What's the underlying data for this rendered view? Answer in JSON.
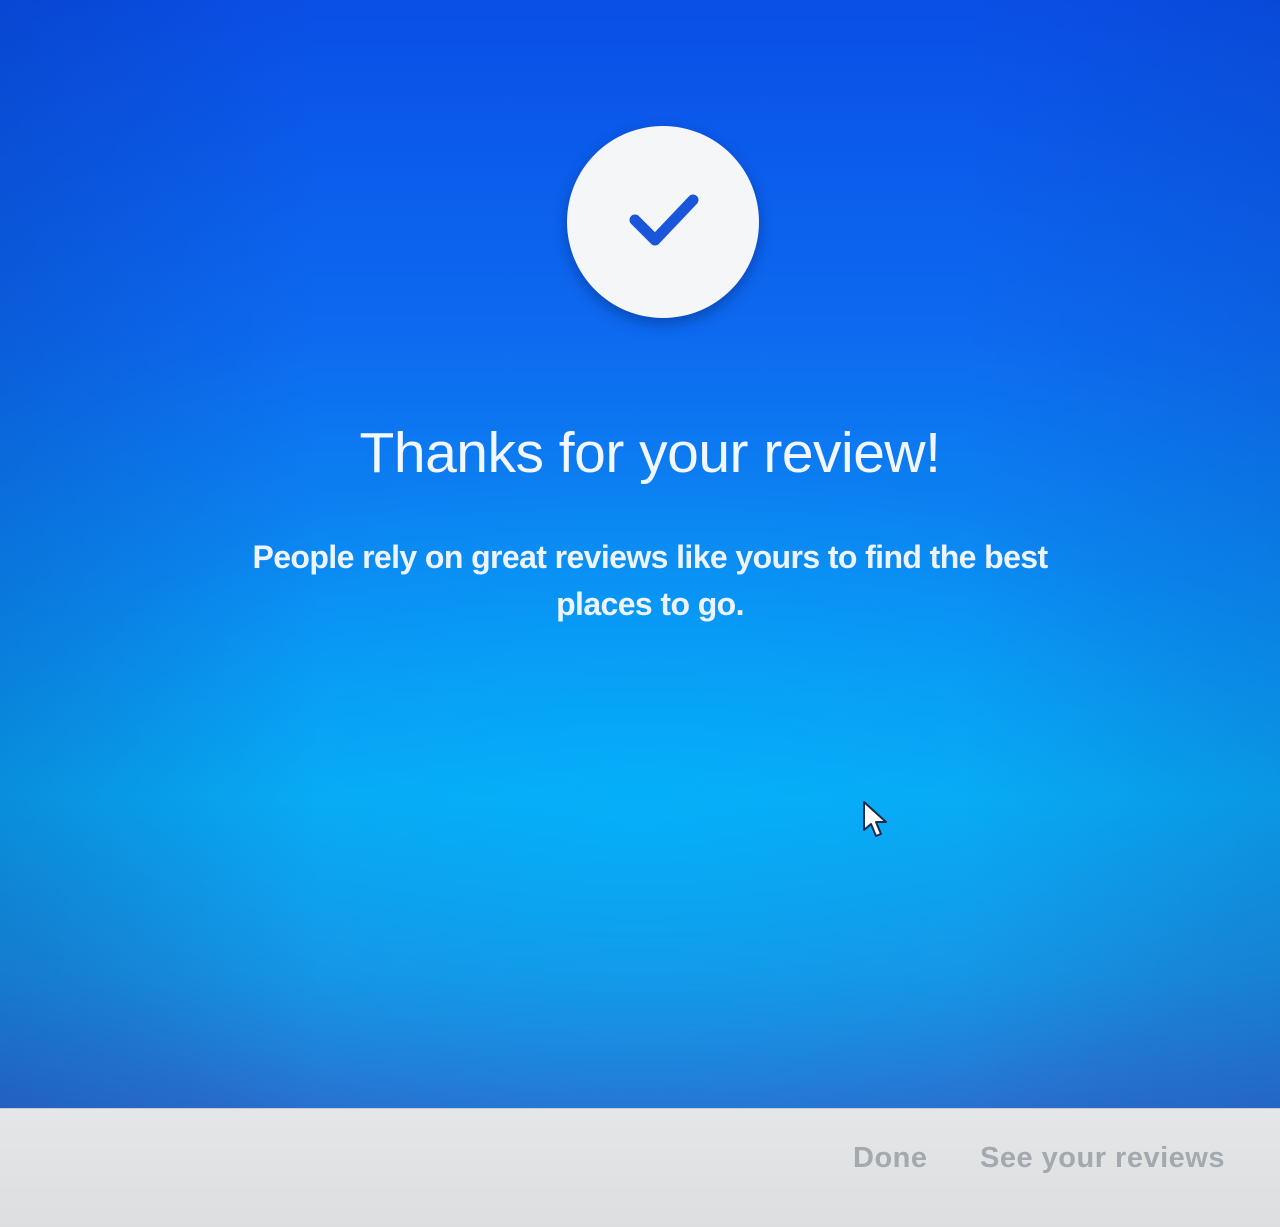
{
  "dialog": {
    "title": "Thanks for your review!",
    "message": "People rely on great reviews like yours to find the best places to go.",
    "badge_icon": "check-icon"
  },
  "footer": {
    "done_label": "Done",
    "see_reviews_label": "See your reviews"
  },
  "colors": {
    "hero_top": "#0a4fe6",
    "hero_bottom": "#0aa8f2",
    "check": "#1a56d9",
    "footer_background": "#dcdee0",
    "footer_button_text": "#a3a9ae"
  }
}
